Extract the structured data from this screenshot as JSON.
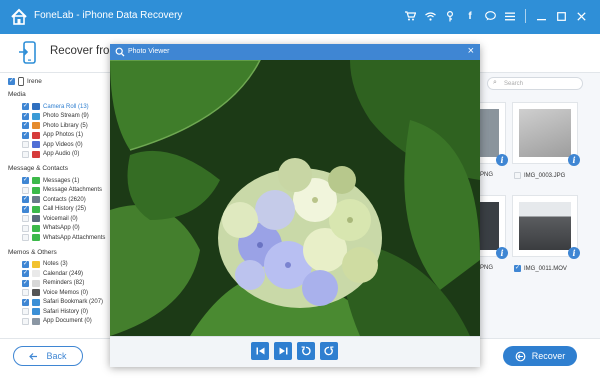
{
  "app": {
    "title": "FoneLab - iPhone Data Recovery"
  },
  "titlebar_icons": [
    "cart-icon",
    "wifi-icon",
    "key-icon",
    "facebook-icon",
    "chat-icon",
    "menu-icon",
    "minimize-icon",
    "maximize-icon",
    "close-icon"
  ],
  "header": {
    "title": "Recover from iPhone"
  },
  "device": {
    "name": "Irene"
  },
  "sidebar": {
    "categories": [
      {
        "label": "Media",
        "items": [
          {
            "label": "Camera Roll (13)",
            "checked": true,
            "selected": true,
            "color": "#2f6fbf"
          },
          {
            "label": "Photo Stream (9)",
            "checked": true,
            "color": "#3b9bd6"
          },
          {
            "label": "Photo Library (5)",
            "checked": true,
            "color": "#e58b2e"
          },
          {
            "label": "App Photos (1)",
            "checked": true,
            "color": "#d63b3b"
          },
          {
            "label": "App Videos (0)",
            "checked": false,
            "color": "#4f6ed6"
          },
          {
            "label": "App Audio (0)",
            "checked": false,
            "color": "#d63b3b"
          }
        ]
      },
      {
        "label": "Message & Contacts",
        "items": [
          {
            "label": "Messages (1)",
            "checked": true,
            "color": "#3cb94a"
          },
          {
            "label": "Message Attachments",
            "checked": false,
            "color": "#3cb94a"
          },
          {
            "label": "Contacts (2620)",
            "checked": true,
            "color": "#6b7a8a"
          },
          {
            "label": "Call History (25)",
            "checked": true,
            "color": "#3cb94a"
          },
          {
            "label": "Voicemail (0)",
            "checked": false,
            "color": "#5a6b7c"
          },
          {
            "label": "WhatsApp (0)",
            "checked": false,
            "color": "#3cb94a"
          },
          {
            "label": "WhatsApp Attachments",
            "checked": false,
            "color": "#3cb94a"
          }
        ]
      },
      {
        "label": "Memos & Others",
        "items": [
          {
            "label": "Notes (3)",
            "checked": true,
            "color": "#f2c230"
          },
          {
            "label": "Calendar (249)",
            "checked": true,
            "color": "#e9e9e9"
          },
          {
            "label": "Reminders (82)",
            "checked": true,
            "color": "#d8d8d8"
          },
          {
            "label": "Voice Memos (0)",
            "checked": false,
            "color": "#555555"
          },
          {
            "label": "Safari Bookmark (207)",
            "checked": true,
            "color": "#3b8fd6"
          },
          {
            "label": "Safari History (0)",
            "checked": false,
            "color": "#3b8fd6"
          },
          {
            "label": "App Document (0)",
            "checked": false,
            "color": "#8a96a3"
          }
        ]
      }
    ]
  },
  "search": {
    "placeholder": "Search"
  },
  "thumbnails": [
    {
      "label": "PNG",
      "checked": false,
      "partial": true
    },
    {
      "label": "IMG_0003.JPG",
      "checked": false
    },
    {
      "label": "PNG",
      "checked": false,
      "partial": true
    },
    {
      "label": "IMG_0011.MOV",
      "checked": true
    }
  ],
  "viewer": {
    "title": "Photo Viewer",
    "controls": [
      "first-icon",
      "last-icon",
      "rotate-left-icon",
      "rotate-right-icon"
    ]
  },
  "footer": {
    "back_label": "Back",
    "recover_label": "Recover"
  },
  "colors": {
    "accent": "#2f7fd0",
    "titlebar": "#2f8fd7"
  }
}
